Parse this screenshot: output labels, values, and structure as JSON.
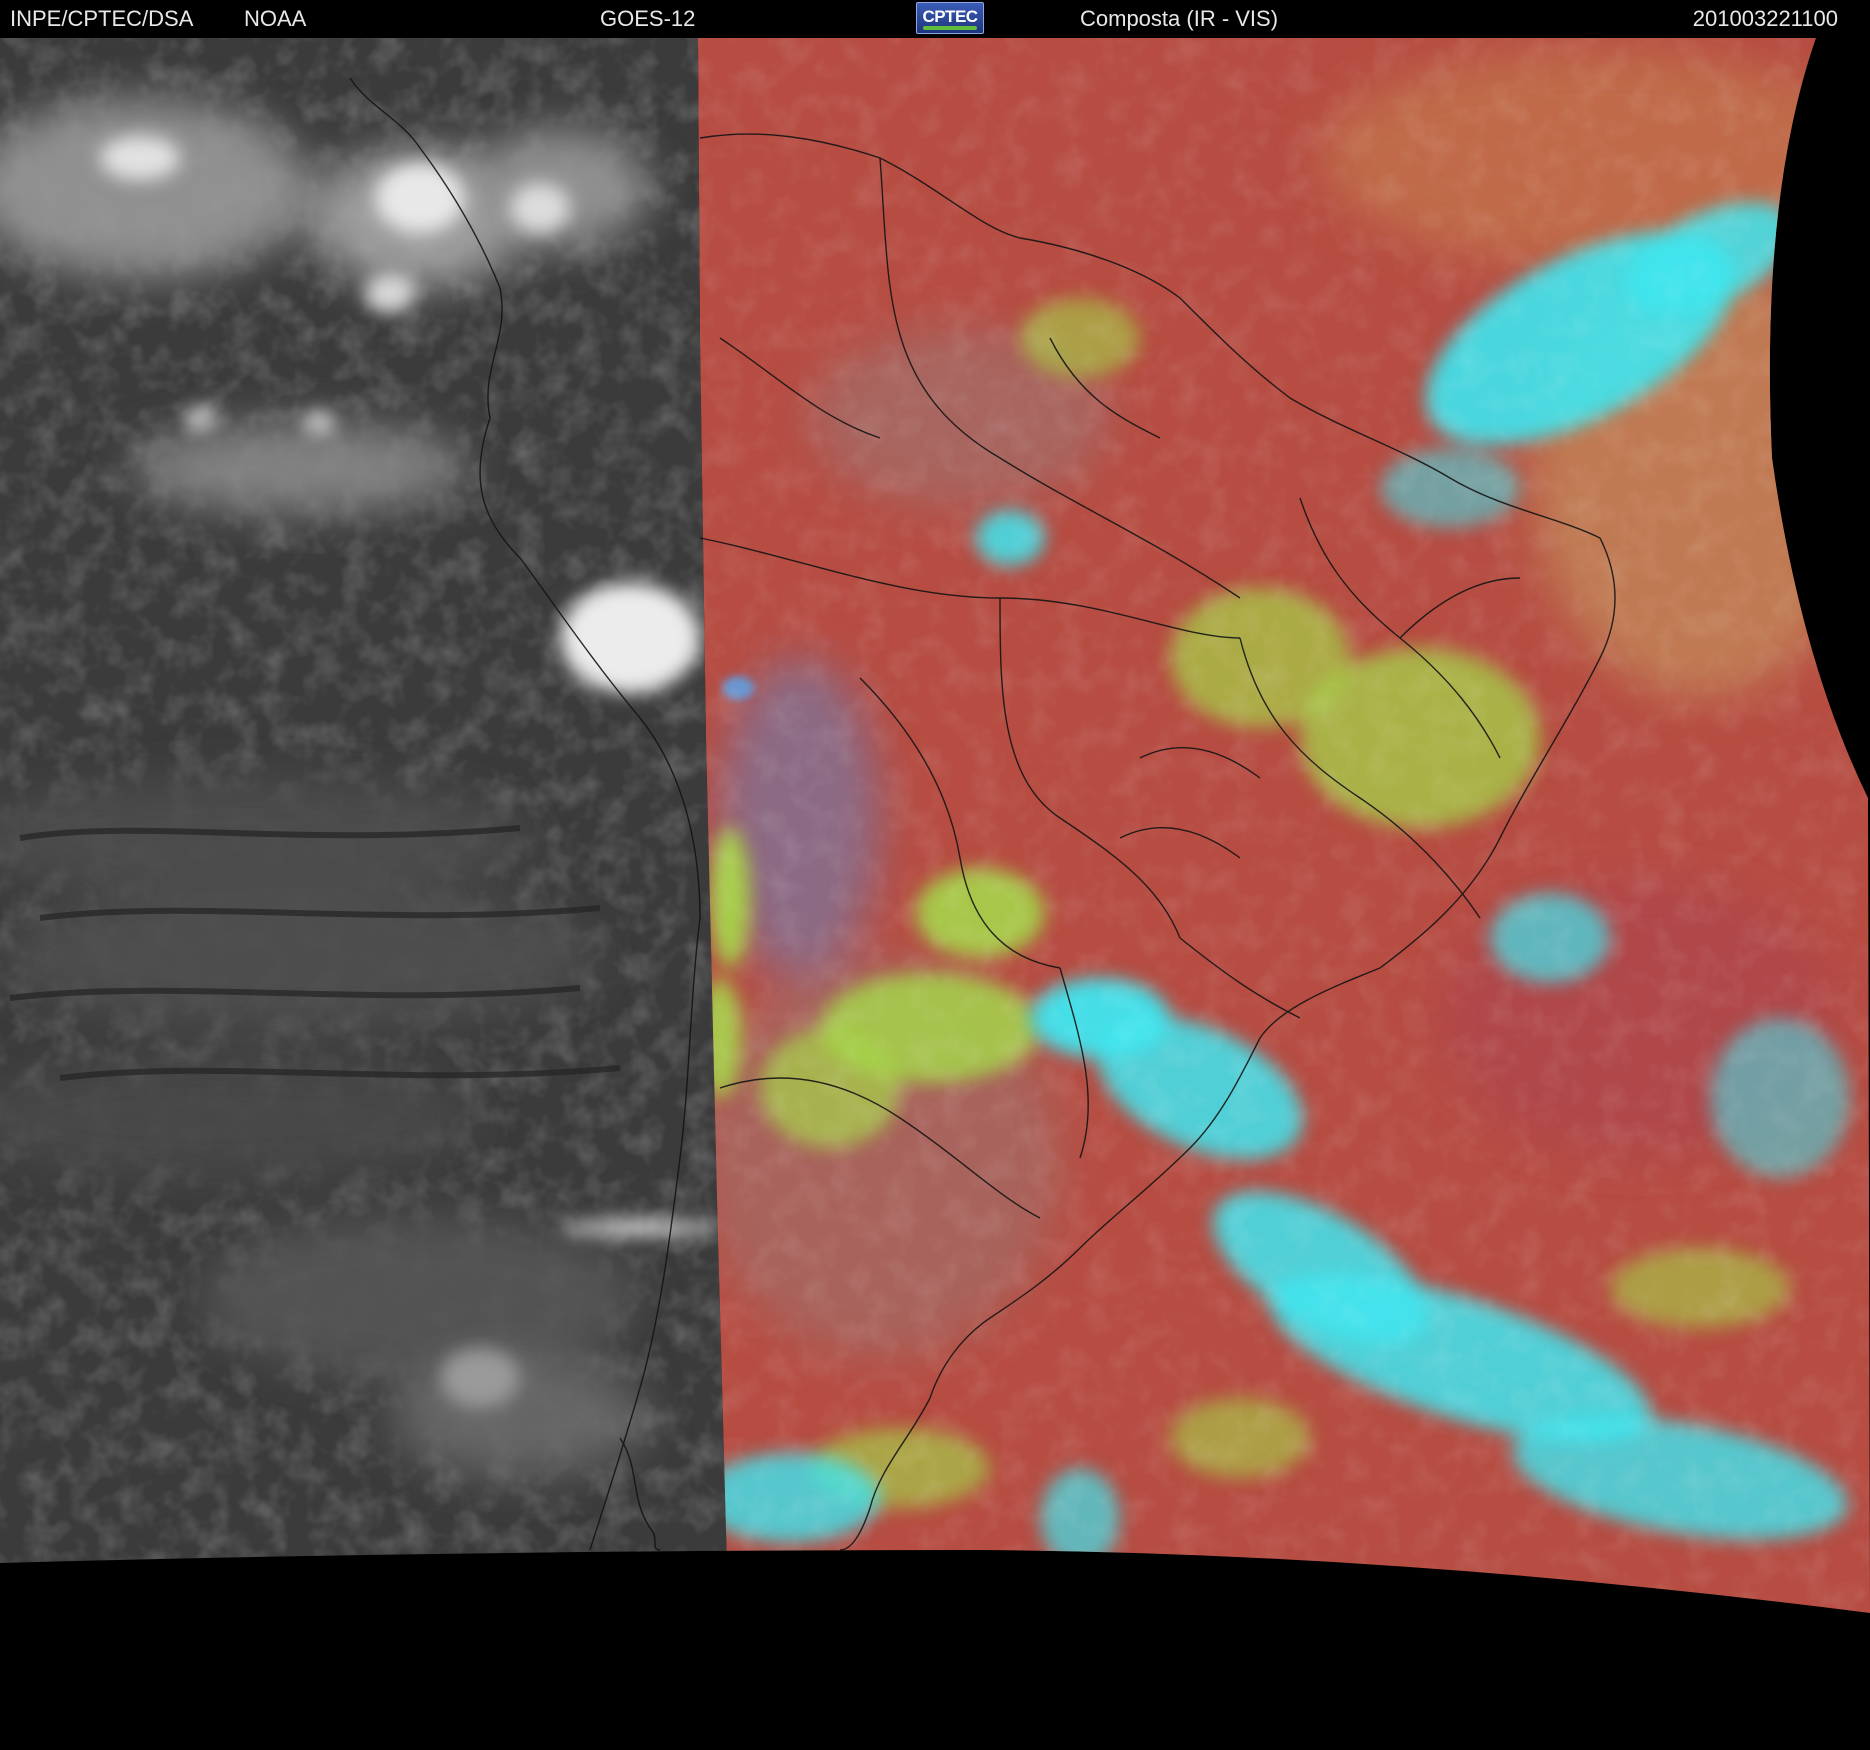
{
  "header": {
    "institution": "INPE/CPTEC/DSA",
    "agency": "NOAA",
    "satellite": "GOES-12",
    "logo_text": "CPTEC",
    "product": "Composta (IR - VIS)",
    "timestamp": "201003221100"
  },
  "map": {
    "colors": {
      "space": "#000000",
      "night_ir": "#3a3a3a",
      "day_land": "#b84a42",
      "ocean_day": "#b85848",
      "cloud_low": "#a8d84a",
      "cloud_high": "#3de8f0",
      "borders": "#111111"
    }
  }
}
